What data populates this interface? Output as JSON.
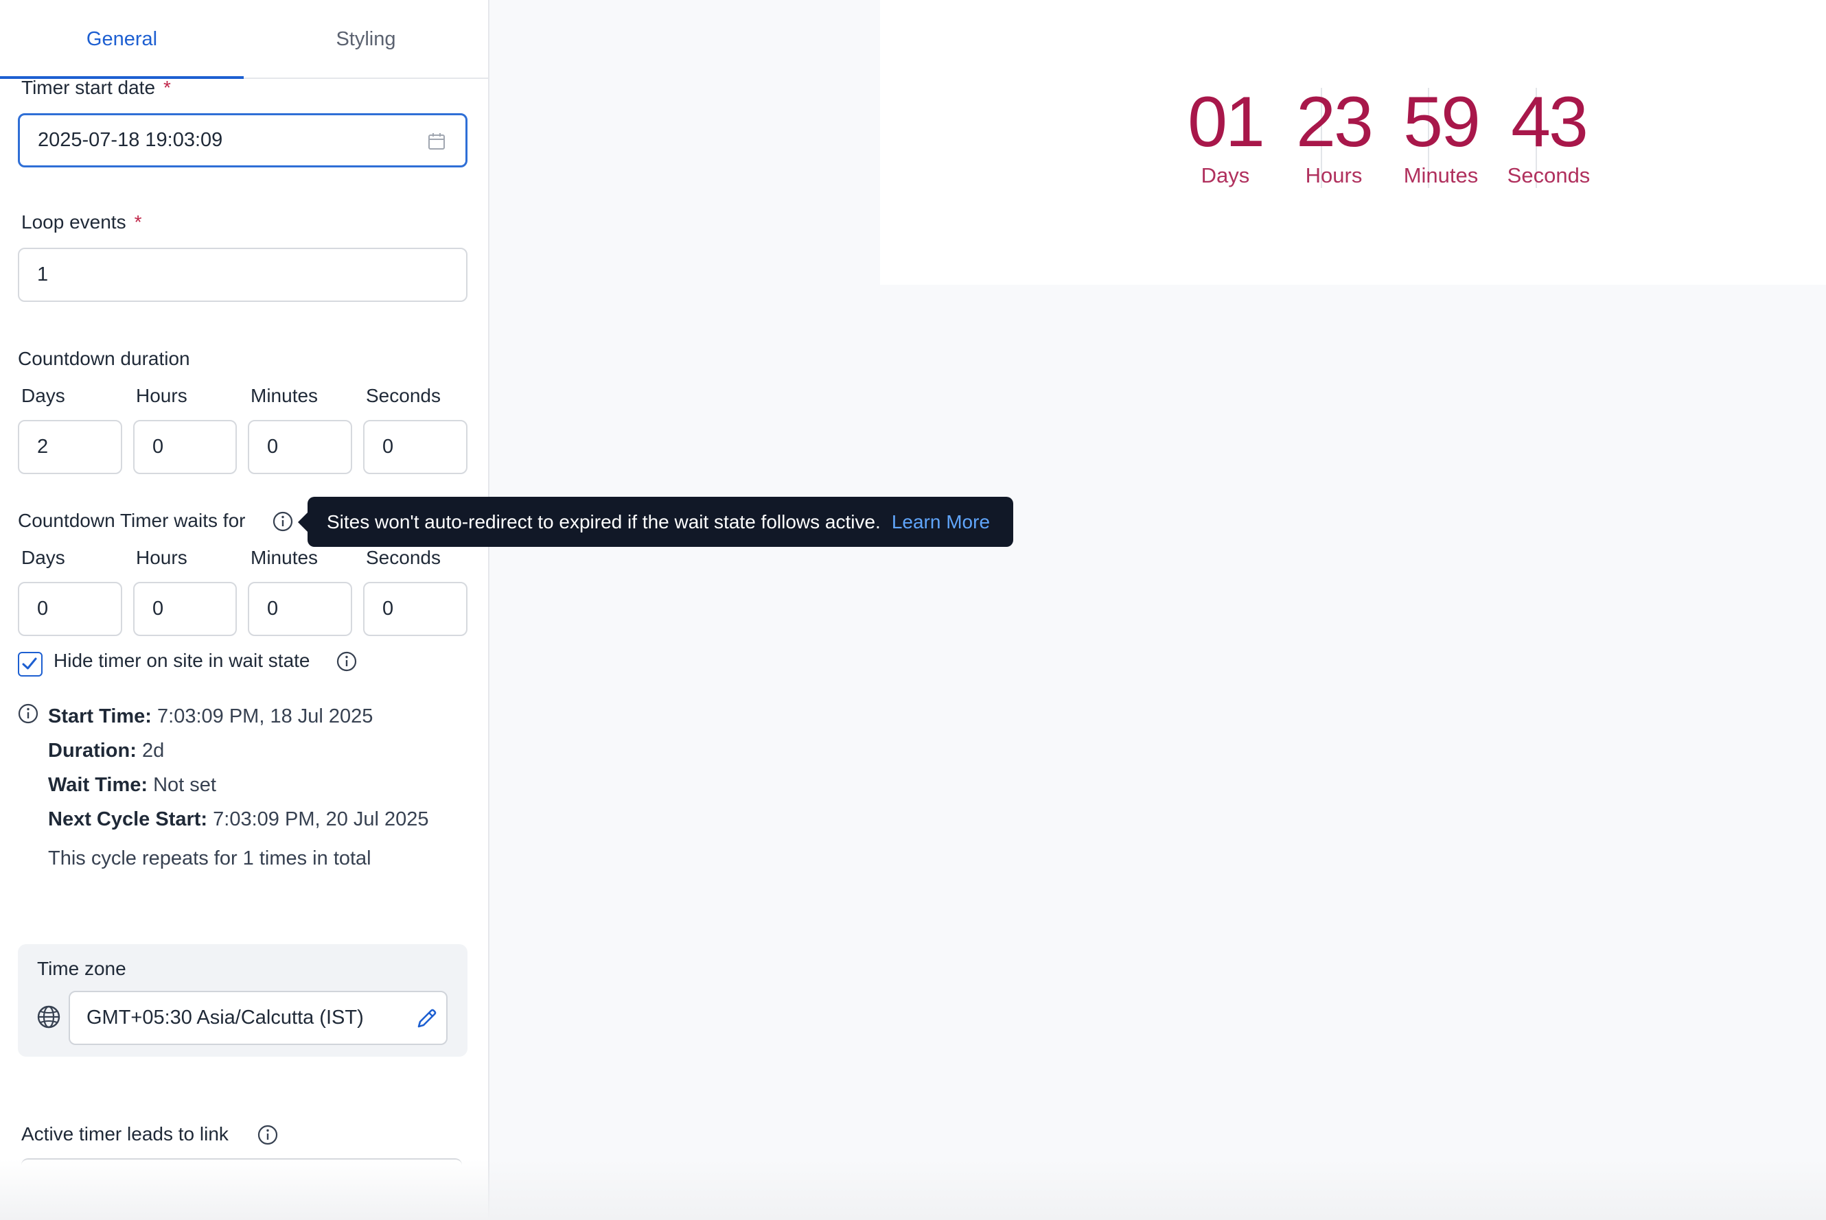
{
  "tabs": {
    "general": "General",
    "styling": "Styling"
  },
  "timer_start": {
    "label": "Timer start date",
    "required_mark": "*",
    "value": "2025-07-18 19:03:09",
    "icon": "calendar-icon"
  },
  "loop_events": {
    "label": "Loop events",
    "required_mark": "*",
    "value": "1"
  },
  "countdown_duration": {
    "label": "Countdown duration",
    "fields": [
      {
        "label": "Days",
        "value": "2"
      },
      {
        "label": "Hours",
        "value": "0"
      },
      {
        "label": "Minutes",
        "value": "0"
      },
      {
        "label": "Seconds",
        "value": "0"
      }
    ]
  },
  "wait": {
    "label": "Countdown Timer waits for",
    "fields": [
      {
        "label": "Days",
        "value": "0"
      },
      {
        "label": "Hours",
        "value": "0"
      },
      {
        "label": "Minutes",
        "value": "0"
      },
      {
        "label": "Seconds",
        "value": "0"
      }
    ]
  },
  "hide_timer": {
    "label": "Hide timer on site in wait state",
    "checked": true
  },
  "summary": {
    "start_key": "Start Time:",
    "start_val": "7:03:09 PM, 18 Jul 2025",
    "duration_key": "Duration:",
    "duration_val": "2d",
    "wait_key": "Wait Time:",
    "wait_val": "Not set",
    "next_key": "Next Cycle Start:",
    "next_val": "7:03:09 PM, 20 Jul 2025",
    "repeat_text": "This cycle repeats for 1 times in total"
  },
  "timezone": {
    "label": "Time zone",
    "value": "GMT+05:30 Asia/Calcutta (IST)"
  },
  "active_link": {
    "label": "Active timer leads to link"
  },
  "tooltip": {
    "text": "Sites won't auto-redirect to expired if the wait state follows active.",
    "link": "Learn More"
  },
  "preview": {
    "color": "#a8174a",
    "units": [
      {
        "value": "01",
        "label": "Days"
      },
      {
        "value": "23",
        "label": "Hours"
      },
      {
        "value": "59",
        "label": "Minutes"
      },
      {
        "value": "43",
        "label": "Seconds"
      }
    ]
  },
  "colors": {
    "accent": "#1d5fd1",
    "timer": "#a8174a",
    "required": "#c0274a"
  }
}
